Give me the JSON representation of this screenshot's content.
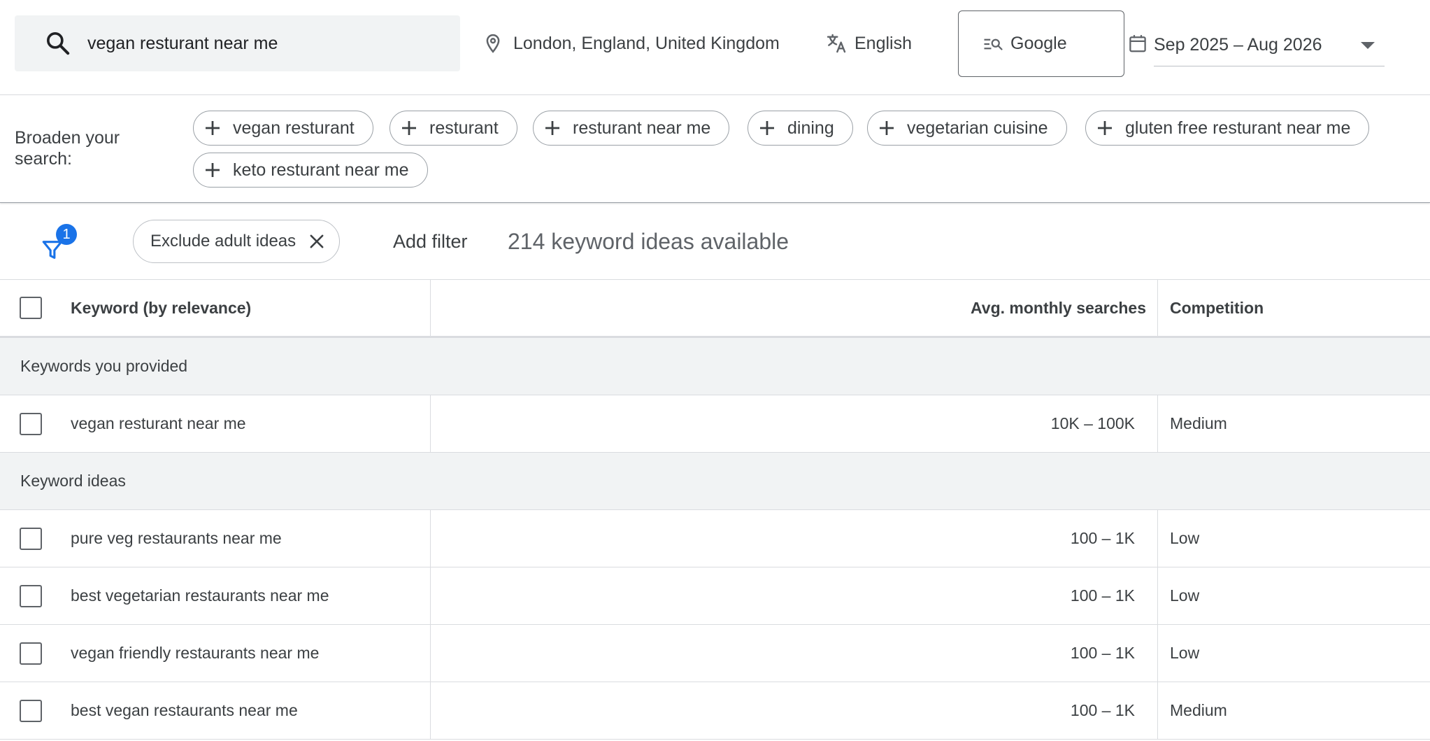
{
  "search": {
    "query": "vegan resturant near me",
    "location": "London, England, United Kingdom",
    "language": "English",
    "engine": "Google",
    "date_range": "Sep 2025 – Aug 2026"
  },
  "broaden": {
    "label": "Broaden your search:",
    "chips": [
      "vegan resturant",
      "resturant",
      "resturant near me",
      "dining",
      "vegetarian cuisine",
      "gluten free resturant near me",
      "keto resturant near me"
    ]
  },
  "filters": {
    "badge_count": "1",
    "active_filter": "Exclude adult ideas",
    "add_filter_label": "Add filter",
    "ideas_count": "214 keyword ideas available"
  },
  "table": {
    "headers": {
      "keyword": "Keyword (by relevance)",
      "searches": "Avg. monthly searches",
      "competition": "Competition"
    },
    "groups": [
      {
        "label": "Keywords you provided",
        "rows": [
          {
            "keyword": "vegan resturant near me",
            "searches": "10K – 100K",
            "competition": "Medium"
          }
        ]
      },
      {
        "label": "Keyword ideas",
        "rows": [
          {
            "keyword": "pure veg restaurants near me",
            "searches": "100 – 1K",
            "competition": "Low"
          },
          {
            "keyword": "best vegetarian restaurants near me",
            "searches": "100 – 1K",
            "competition": "Low"
          },
          {
            "keyword": "vegan friendly restaurants near me",
            "searches": "100 – 1K",
            "competition": "Low"
          },
          {
            "keyword": "best vegan restaurants near me",
            "searches": "100 – 1K",
            "competition": "Medium"
          }
        ]
      }
    ]
  },
  "colors": {
    "accent": "#1a73e8",
    "group_bg": "#f1f3f4",
    "border": "#dadce0"
  }
}
